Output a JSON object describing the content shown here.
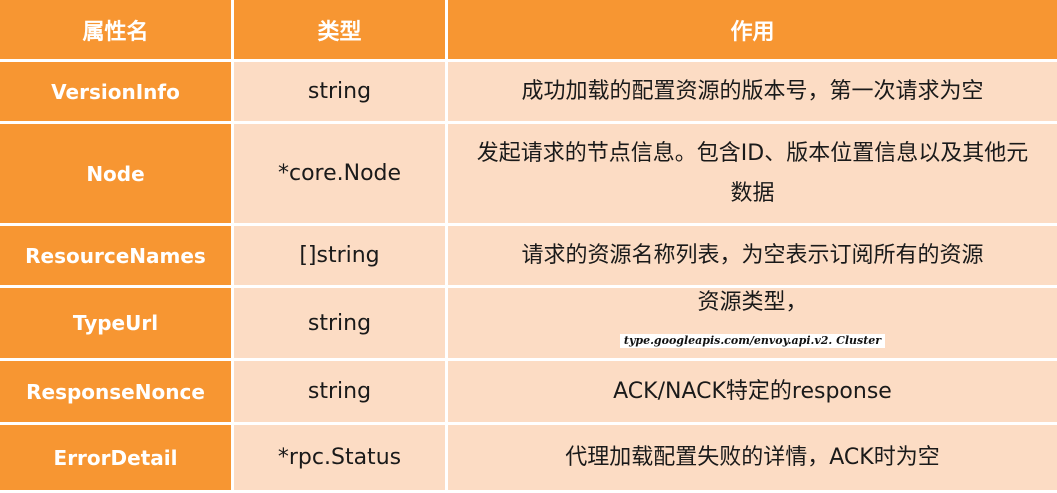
{
  "table": {
    "headers": [
      "属性名",
      "类型",
      "作用"
    ],
    "rows": [
      {
        "name": "VersionInfo",
        "type": "string",
        "desc": "成功加载的配置资源的版本号，第一次请求为空"
      },
      {
        "name": "Node",
        "type": "*core.Node",
        "desc": "发起请求的节点信息。包含ID、版本位置信息以及其他元数据"
      },
      {
        "name": "ResourceNames",
        "type": "[]string",
        "desc": "请求的资源名称列表，为空表示订阅所有的资源"
      },
      {
        "name": "TypeUrl",
        "type": "string",
        "desc": "资源类型，",
        "desc_sub": "type.googleapis.com/envoy.api.v2. Cluster"
      },
      {
        "name": "ResponseNonce",
        "type": "string",
        "desc": "ACK/NACK特定的response"
      },
      {
        "name": "ErrorDetail",
        "type": "*rpc.Status",
        "desc": "代理加载配置失败的详情，ACK时为空"
      }
    ]
  },
  "colors": {
    "header_bg": "#f79632",
    "name_bg": "#f79632",
    "cell_bg": "#fcdcc4"
  }
}
